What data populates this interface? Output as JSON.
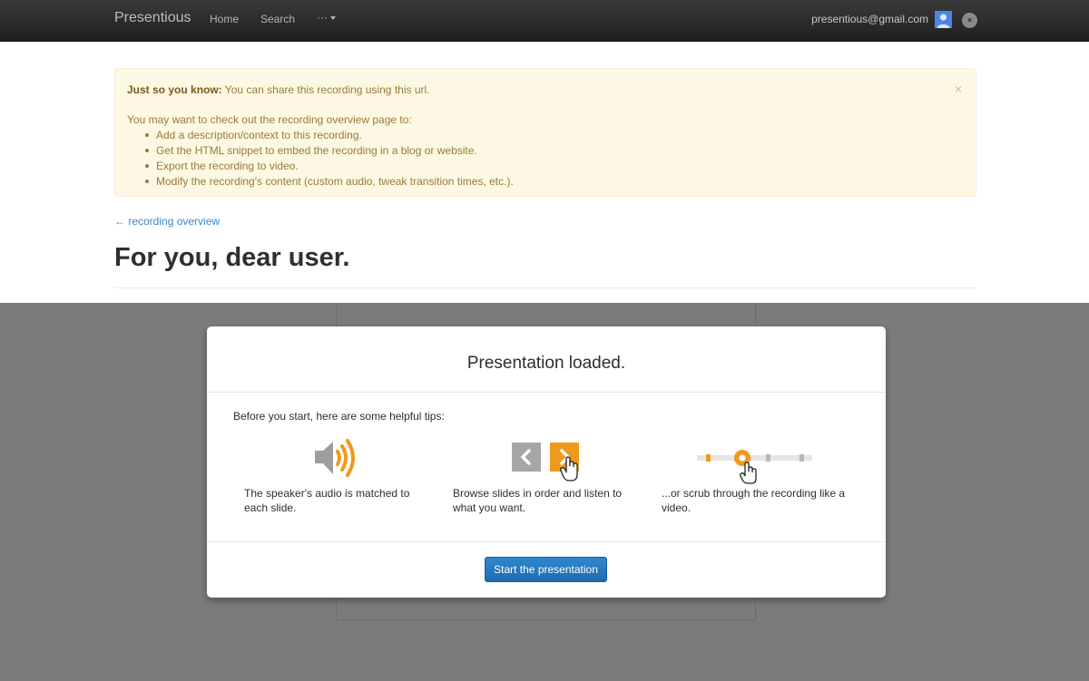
{
  "navbar": {
    "brand": "Presentious",
    "home": "Home",
    "search": "Search",
    "more": "···",
    "user_email": "presentious@gmail.com",
    "logout_glyph": "×"
  },
  "alert": {
    "bold_lead": "Just so you know:",
    "message": " You can share this recording using this url.",
    "intro": "You may want to check out the recording overview page to:",
    "items": [
      "Add a description/context to this recording.",
      "Get the HTML snippet to embed the recording in a blog or website.",
      "Export the recording to video.",
      "Modify the recording's content (custom audio, tweak transition times, etc.)."
    ],
    "close_glyph": "×"
  },
  "back_link": "← recording overview",
  "page_title": "For you, dear user.",
  "modal": {
    "title": "Presentation loaded.",
    "intro": "Before you start, here are some helpful tips:",
    "tips": [
      {
        "icon": "speaker-icon",
        "text": "The speaker's audio is matched to each slide."
      },
      {
        "icon": "prev-next-arrows-icon",
        "text": "Browse slides in order and listen to what you want."
      },
      {
        "icon": "scrubber-icon",
        "text": "...or scrub through the recording like a video."
      }
    ],
    "start_button": "Start the presentation"
  },
  "colors": {
    "accent_orange": "#ef9a1d",
    "primary_blue": "#2478c0",
    "alert_bg": "#fcf8e3",
    "overlay": "#7b7b7b"
  }
}
